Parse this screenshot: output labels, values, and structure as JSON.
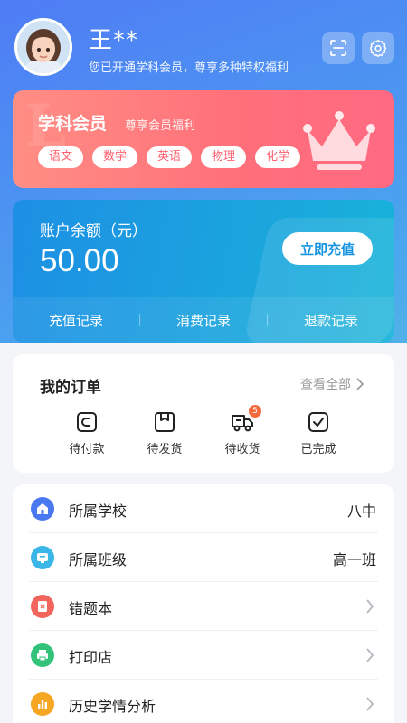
{
  "user": {
    "name": "王**",
    "subtitle": "您已开通学科会员，尊享多种特权福利"
  },
  "header_buttons": [
    "scan-icon",
    "settings-icon"
  ],
  "membership": {
    "title": "学科会员",
    "subtitle": "尊享会员福利",
    "subjects": [
      "语文",
      "数学",
      "英语",
      "物理",
      "化学"
    ]
  },
  "balance": {
    "label": "账户余额（元）",
    "value": "50.00",
    "recharge_label": "立即充值",
    "links": [
      "充值记录",
      "消费记录",
      "退款记录"
    ]
  },
  "orders": {
    "title": "我的订单",
    "view_all": "查看全部",
    "items": [
      {
        "label": "待付款",
        "icon": "wallet-icon"
      },
      {
        "label": "待发货",
        "icon": "package-icon"
      },
      {
        "label": "待收货",
        "icon": "truck-icon",
        "badge": "5"
      },
      {
        "label": "已完成",
        "icon": "check-square-icon"
      }
    ]
  },
  "menu": [
    {
      "label": "所属学校",
      "value": "八中",
      "icon": "school-icon",
      "color": "#4a78f0"
    },
    {
      "label": "所属班级",
      "value": "高一班",
      "icon": "class-icon",
      "color": "#3bb6e8"
    },
    {
      "label": "错题本",
      "value": "",
      "icon": "notebook-icon",
      "color": "#f2655c"
    },
    {
      "label": "打印店",
      "value": "",
      "icon": "printer-icon",
      "color": "#33c27a"
    },
    {
      "label": "历史学情分析",
      "value": "",
      "icon": "chart-icon",
      "color": "#f5a623"
    }
  ],
  "colors": {
    "member_gradient_start": "#ff8e84",
    "member_gradient_end": "#ff6a82",
    "balance_gradient_start": "#1d8fe4",
    "balance_gradient_end": "#18b3d9",
    "accent_blue": "#1694e1",
    "badge": "#f26a3c"
  }
}
